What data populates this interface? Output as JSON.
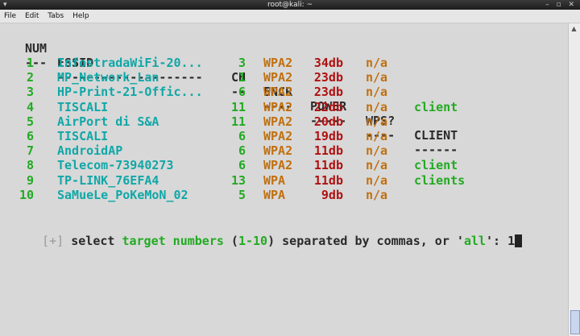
{
  "window": {
    "title": "root@kali: ~",
    "window_menu_glyph": "▾",
    "controls": "– ▫ ✕"
  },
  "menubar": {
    "items": [
      {
        "label": "File"
      },
      {
        "label": "Edit"
      },
      {
        "label": "Tabs"
      },
      {
        "label": "Help"
      }
    ]
  },
  "table": {
    "headers": {
      "num": "NUM",
      "essid": "ESSID",
      "ch": "CH",
      "encr": "ENCR",
      "power": "POWER",
      "wps": "WPS?",
      "client": "CLIENT"
    },
    "separators": {
      "num": "---",
      "essid": "--------------------",
      "ch": "--",
      "encr": "----",
      "power": "-----",
      "wps": "----",
      "client": "------"
    },
    "rows": [
      {
        "num": "1",
        "essid": "InfostradaWiFi-20...",
        "ch": "3",
        "encr": "WPA2",
        "power": "34db",
        "wps": "n/a",
        "client": ""
      },
      {
        "num": "2",
        "essid": "MP_Network_Lan",
        "ch": "1",
        "encr": "WPA2",
        "power": "23db",
        "wps": "n/a",
        "client": ""
      },
      {
        "num": "3",
        "essid": "HP-Print-21-Offic...",
        "ch": "6",
        "encr": "WPA2",
        "power": "23db",
        "wps": "n/a",
        "client": ""
      },
      {
        "num": "4",
        "essid": "TISCALI",
        "ch": "11",
        "encr": "WPA2",
        "power": "22db",
        "wps": "n/a",
        "client": "client"
      },
      {
        "num": "5",
        "essid": "AirPort di S&A",
        "ch": "11",
        "encr": "WPA2",
        "power": "20db",
        "wps": "n/a",
        "client": ""
      },
      {
        "num": "6",
        "essid": "TISCALI",
        "ch": "6",
        "encr": "WPA2",
        "power": "19db",
        "wps": "n/a",
        "client": ""
      },
      {
        "num": "7",
        "essid": "AndroidAP",
        "ch": "6",
        "encr": "WPA2",
        "power": "11db",
        "wps": "n/a",
        "client": ""
      },
      {
        "num": "8",
        "essid": "Telecom-73940273",
        "ch": "6",
        "encr": "WPA2",
        "power": "11db",
        "wps": "n/a",
        "client": "client"
      },
      {
        "num": "9",
        "essid": "TP-LINK_76EFA4",
        "ch": "13",
        "encr": "WPA",
        "power": "11db",
        "wps": "n/a",
        "client": "clients"
      },
      {
        "num": "10",
        "essid": "SaMueLe_PoKeMoN_02",
        "ch": "5",
        "encr": "WPA",
        "power": "9db",
        "wps": "n/a",
        "client": ""
      }
    ]
  },
  "prompt": {
    "marker": "[+]",
    "text1": " select ",
    "green1": "target numbers",
    "text2": " (",
    "green2": "1-10",
    "text3": ") separated by commas, or '",
    "green3": "all",
    "text4": "': ",
    "input_value": "1"
  },
  "colors": {
    "num_green": "#22aa22",
    "essid_cyan": "#11a7a7",
    "encr_orange": "#c07010",
    "power_red": "#b01010",
    "background": "#d8d8d8"
  }
}
